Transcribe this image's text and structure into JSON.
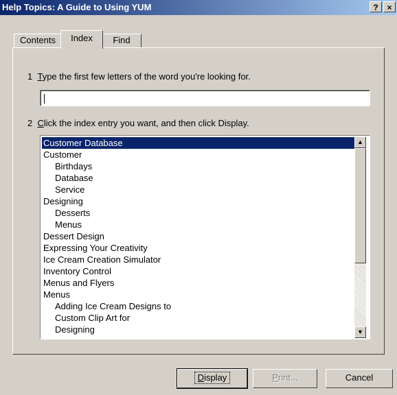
{
  "window": {
    "title": "Help Topics: A Guide to Using YUM",
    "help_button": "?",
    "close_button": "×"
  },
  "tabs": [
    {
      "label": "Contents"
    },
    {
      "label": "Index",
      "active": true
    },
    {
      "label": "Find"
    }
  ],
  "step1": {
    "number": "1",
    "accel": "T",
    "rest": "ype the first few letters of the word you're looking for.",
    "input_value": ""
  },
  "step2": {
    "number": "2",
    "accel": "C",
    "rest": "lick the index entry you want, and then click Display."
  },
  "index_entries": [
    {
      "text": "Customer Database",
      "level": 0,
      "selected": true
    },
    {
      "text": "Customer",
      "level": 0
    },
    {
      "text": "Birthdays",
      "level": 1
    },
    {
      "text": "Database",
      "level": 1
    },
    {
      "text": "Service",
      "level": 1
    },
    {
      "text": "Designing",
      "level": 0
    },
    {
      "text": "Desserts",
      "level": 1
    },
    {
      "text": "Menus",
      "level": 1
    },
    {
      "text": "Dessert Design",
      "level": 0
    },
    {
      "text": "Expressing Your Creativity",
      "level": 0
    },
    {
      "text": "Ice Cream Creation Simulator",
      "level": 0
    },
    {
      "text": "Inventory Control",
      "level": 0
    },
    {
      "text": "Menus and Flyers",
      "level": 0
    },
    {
      "text": "Menus",
      "level": 0
    },
    {
      "text": "Adding Ice Cream Designs to",
      "level": 1
    },
    {
      "text": "Custom Clip Art for",
      "level": 1
    },
    {
      "text": "Designing",
      "level": 1
    }
  ],
  "scroll_icons": {
    "up": "▲",
    "down": "▼"
  },
  "buttons": {
    "display_accel": "D",
    "display_rest": "isplay",
    "print_accel": "P",
    "print_rest": "rint...",
    "cancel": "Cancel"
  },
  "colors": {
    "window_bg": "#d4d0c8",
    "title_start": "#0a246a",
    "title_end": "#a6caf0",
    "selection": "#0a246a"
  }
}
